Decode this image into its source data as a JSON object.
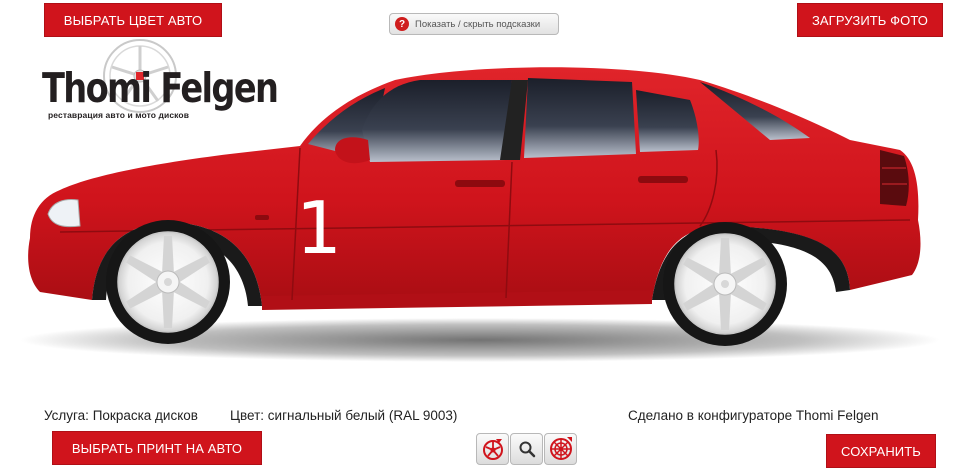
{
  "toolbar": {
    "choose_color_label": "ВЫБРАТЬ ЦВЕТ АВТО",
    "upload_photo_label": "ЗАГРУЗИТЬ ФОТО",
    "hints_label": "Показать / скрыть подсказки",
    "hints_icon": "?"
  },
  "logo": {
    "title": "Thomi Felgen",
    "subtitle": "реставрация авто и мото дисков"
  },
  "car": {
    "body_color": "#d7141c",
    "wheel_color": "#f2f2f2",
    "number": "1"
  },
  "info": {
    "service_label": "Услуга:",
    "service_value": "Покраска дисков",
    "color_label": "Цвет:",
    "color_value": "сигнальный белый (RAL 9003)",
    "made_in": "Сделано в конфигураторе Thomi Felgen"
  },
  "bottom": {
    "choose_print_label": "ВЫБРАТЬ ПРИНТ НА АВТО",
    "save_label": "СОХРАНИТЬ"
  },
  "colors": {
    "accent": "#d0141c"
  }
}
